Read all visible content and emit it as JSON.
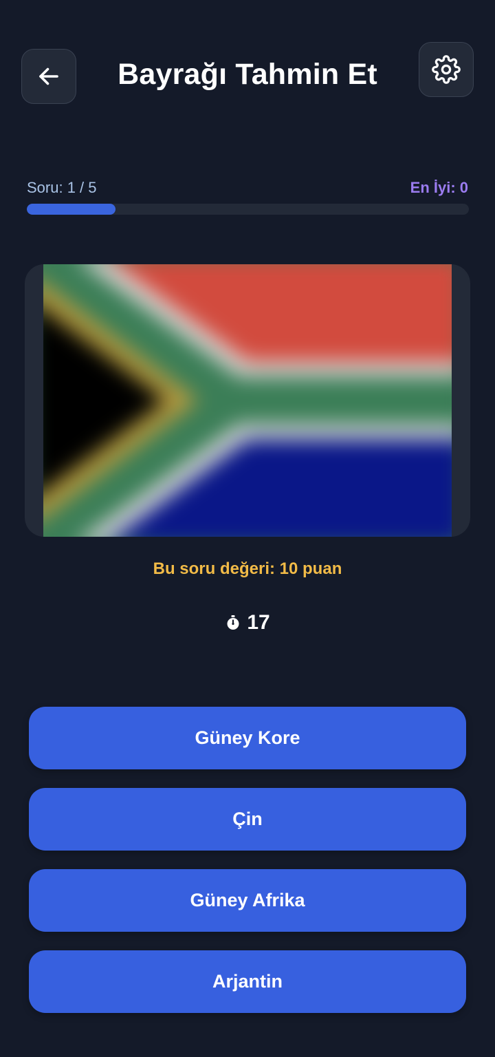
{
  "header": {
    "title": "Bayrağı Tahmin Et",
    "back_icon": "arrow-left-icon",
    "settings_icon": "gear-icon"
  },
  "progress": {
    "label": "Soru: 1 / 5",
    "best_label": "En İyi: 0",
    "fraction": 0.2
  },
  "flag": {
    "colors": {
      "red": "#d24b3e",
      "blue": "#0a1788",
      "green": "#3b7e57",
      "white": "#dcdcdc",
      "gold": "#b59a3e",
      "black": "#000000"
    }
  },
  "question": {
    "points_label": "Bu soru değeri: 10 puan",
    "timer_icon": "stopwatch-icon",
    "timer_value": "17"
  },
  "answers": [
    {
      "label": "Güney Kore"
    },
    {
      "label": "Çin"
    },
    {
      "label": "Güney Afrika"
    },
    {
      "label": "Arjantin"
    }
  ],
  "colors": {
    "background": "#141a29",
    "card": "#232a38",
    "accent": "#3760df",
    "points": "#f2bb47",
    "best": "#9b7cf0"
  }
}
